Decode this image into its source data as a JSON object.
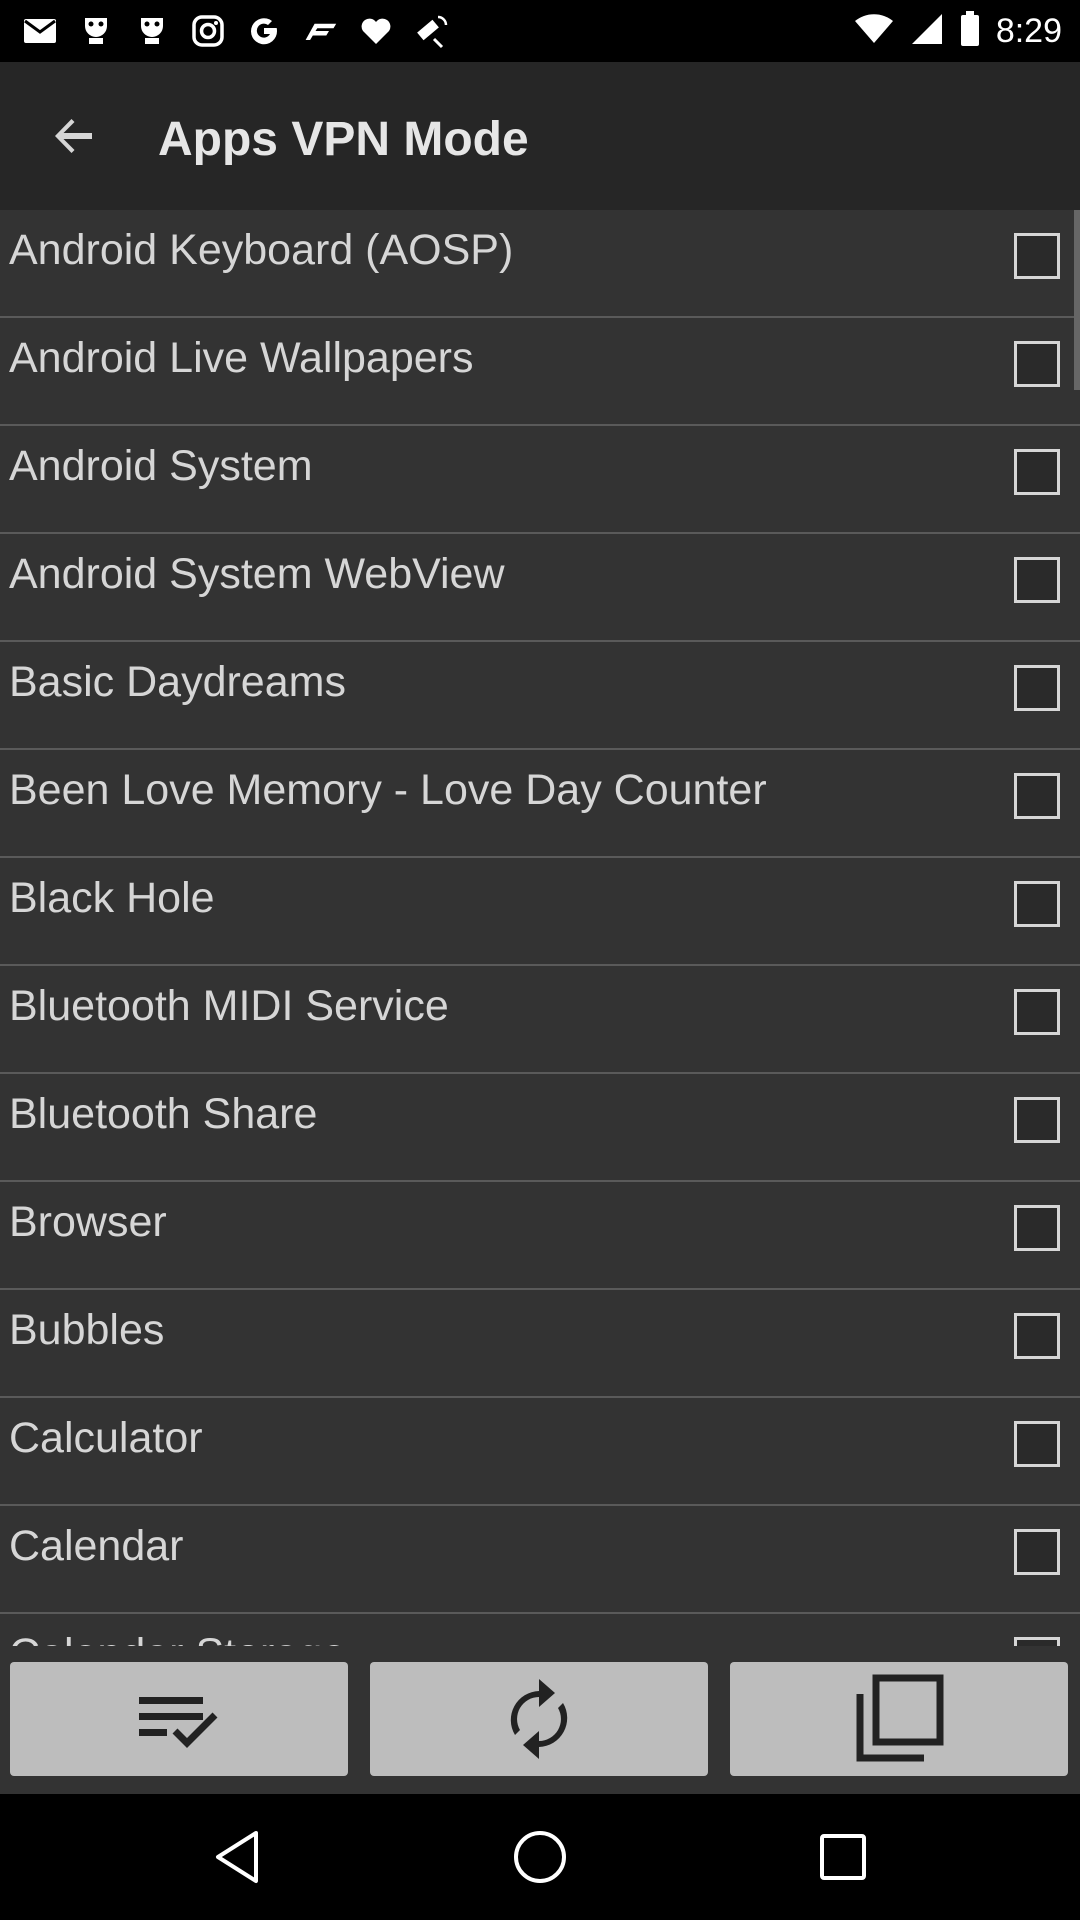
{
  "status_bar": {
    "time": "8:29",
    "left_icons": [
      "mail-icon",
      "game-icon",
      "game-icon",
      "instagram-icon",
      "g-icon",
      "f1-icon",
      "heart-icon",
      "fake-gps-icon"
    ],
    "right_icons": [
      "wifi-icon",
      "signal-icon",
      "battery-icon"
    ]
  },
  "app_bar": {
    "title": "Apps VPN Mode",
    "back_icon": "arrow-back-icon"
  },
  "apps": [
    {
      "name": "Android Keyboard (AOSP)",
      "checked": false
    },
    {
      "name": "Android Live Wallpapers",
      "checked": false
    },
    {
      "name": "Android System",
      "checked": false
    },
    {
      "name": "Android System WebView",
      "checked": false
    },
    {
      "name": "Basic Daydreams",
      "checked": false
    },
    {
      "name": "Been Love Memory - Love Day Counter",
      "checked": false
    },
    {
      "name": "Black Hole",
      "checked": false
    },
    {
      "name": "Bluetooth MIDI Service",
      "checked": false
    },
    {
      "name": "Bluetooth Share",
      "checked": false
    },
    {
      "name": "Browser",
      "checked": false
    },
    {
      "name": "Bubbles",
      "checked": false
    },
    {
      "name": "Calculator",
      "checked": false
    },
    {
      "name": "Calendar",
      "checked": false
    },
    {
      "name": "Calendar Storage",
      "checked": false
    }
  ],
  "bottom_actions": [
    "select-all-icon",
    "refresh-icon",
    "copy-icon"
  ],
  "nav_bar": [
    "back-triangle-icon",
    "home-circle-icon",
    "recents-square-icon"
  ],
  "colors": {
    "background": "#333333",
    "app_bar": "#262626",
    "button": "#bdbdbd",
    "text": "#d6d6d6"
  }
}
